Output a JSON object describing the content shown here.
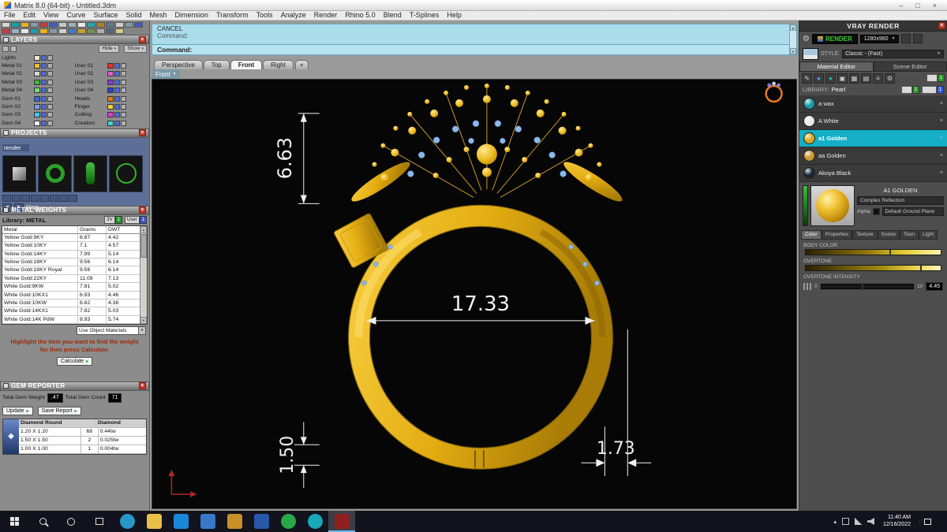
{
  "window": {
    "title": "Matrix 8.0 (64-bit) - Untitled.3dm",
    "minimize": "–",
    "maximize": "□",
    "close": "×"
  },
  "menu": {
    "items": [
      "File",
      "Edit",
      "View",
      "Curve",
      "Surface",
      "Solid",
      "Mesh",
      "Dimension",
      "Transform",
      "Tools",
      "Analyze",
      "Render",
      "Rhino 5.0",
      "Blend",
      "T-Splines",
      "Help"
    ]
  },
  "toolbar": {
    "icons": [
      "#d8d8d8",
      "#18a0a8",
      "#e8b020",
      "#8898a8",
      "#c04040",
      "#4060c0",
      "#c8c8c8",
      "#98b0c0",
      "#e8e8e8",
      "#20a8b0",
      "#b08020",
      "#607890",
      "#d0d0d0",
      "#8898a8",
      "#4060c0",
      "#c04040",
      "#98b0c0",
      "#e8e8e8",
      "#18a0a8",
      "#e8b020",
      "#8898a8",
      "#d0d0d0",
      "#4878c8",
      "#c8a030",
      "#789058",
      "#b0b0b0",
      "#506880",
      "#d8c890"
    ]
  },
  "layers": {
    "title": "LAYERS",
    "hide_label": "Hide",
    "show_label": "Show",
    "rows": [
      {
        "l_label": "Lights",
        "l_color": "#f0ead0",
        "r_label": "",
        "r_color": "transparent"
      },
      {
        "l_label": "Metal 01",
        "l_color": "#e8c030",
        "r_label": "User 01",
        "r_color": "#e03030"
      },
      {
        "l_label": "Metal 02",
        "l_color": "#d8d8d8",
        "r_label": "User 02",
        "r_color": "#e060d0"
      },
      {
        "l_label": "Metal 03",
        "l_color": "#38b838",
        "r_label": "User 03",
        "r_color": "#8040d0"
      },
      {
        "l_label": "Metal 04",
        "l_color": "#70e070",
        "r_label": "User 04",
        "r_color": "#3040c8"
      },
      {
        "l_label": "Gem 01",
        "l_color": "#3868e0",
        "r_label": "Heads",
        "r_color": "#e07820"
      },
      {
        "l_label": "Gem 02",
        "l_color": "#78a0f0",
        "r_label": "Finger",
        "r_color": "#e8d040"
      },
      {
        "l_label": "Gem 03",
        "l_color": "#40c8e8",
        "r_label": "Cutting",
        "r_color": "#d840c8"
      },
      {
        "l_label": "Gem 04",
        "l_color": "#f0f0f0",
        "r_label": "Creation",
        "r_color": "#40d8d0"
      }
    ]
  },
  "projects": {
    "title": "PROJECTS",
    "item_label": "render",
    "nav_label": "Magr"
  },
  "metal_weights": {
    "title": "METAL WEIGHTS",
    "library_label": "Library: METAL",
    "toggle_3v": "3V",
    "toggle_user": "User",
    "toggle_val": "1",
    "columns": [
      "Metal",
      "Grams",
      "DWT"
    ],
    "rows": [
      [
        "Yellow Gold:9KY",
        "6.87",
        "4.42"
      ],
      [
        "Yellow Gold:10KY",
        "7.1",
        "4.57"
      ],
      [
        "Yellow Gold:14KY",
        "7.99",
        "5.14"
      ],
      [
        "Yellow Gold:18KY",
        "9.56",
        "6.14"
      ],
      [
        "Yellow Gold:18KY Royal",
        "9.56",
        "6.14"
      ],
      [
        "Yellow Gold:22KY",
        "11.09",
        "7.13"
      ],
      [
        "White Gold:9KW",
        "7.81",
        "5.02"
      ],
      [
        "White Gold:10KX1",
        "6.93",
        "4.46"
      ],
      [
        "White Gold:10KW",
        "6.82",
        "4.38"
      ],
      [
        "White Gold:14KX1",
        "7.82",
        "5.03"
      ],
      [
        "White Gold:14K PdW",
        "8.93",
        "5.74"
      ]
    ],
    "materials_dropdown": "Use Object Materials",
    "hint_line1": "Highlight the item you want to find the weight",
    "hint_line2": "for then press Calculate.",
    "calculate_label": "Calculate"
  },
  "gem_reporter": {
    "title": "GEM REPORTER",
    "total_weight_label": "Total Gem Weight",
    "total_weight_value": ".47",
    "total_count_label": "Total Gem Count",
    "total_count_value": "71",
    "update_label": "Update",
    "save_label": "Save Report",
    "table": {
      "header1": "Diamond Round",
      "header2": "Diamond",
      "rows": [
        [
          "1.20 X 1.20",
          "68",
          "0.44tw"
        ],
        [
          "1.50 X 1.50",
          "2",
          "0.025tw"
        ],
        [
          "1.00 X 1.00",
          "1",
          "0.004tw"
        ]
      ]
    }
  },
  "command": {
    "cancel_label": "CANCEL",
    "line2": "Command:",
    "prompt": "Command:"
  },
  "viewport": {
    "tabs": [
      {
        "label": "Perspective"
      },
      {
        "label": "Top"
      },
      {
        "label": "Front",
        "selected": true
      },
      {
        "label": "Right"
      }
    ],
    "plus_label": "+",
    "view_chip": "Front",
    "dim_height": "6.63",
    "dim_diameter": "17.33",
    "dim_thickness": "1.50",
    "dim_width": "1.73"
  },
  "vray": {
    "title": "VRAY RENDER",
    "render_label": "RENDER",
    "resolution": "1280x960",
    "style_label": "STYLE:",
    "style_value": "Classic - (Fast)",
    "tab_material": "Material Editor",
    "tab_scene": "Scene Editor",
    "tools": [
      {
        "name": "eyedropper-icon",
        "glyph": "✎",
        "color": "#d8d8d8"
      },
      {
        "name": "sphere-blue-icon",
        "glyph": "●",
        "color": "#48a0e8"
      },
      {
        "name": "sphere-teal-icon",
        "glyph": "●",
        "color": "#20b8a8"
      },
      {
        "name": "box-icon",
        "glyph": "▣",
        "color": "#d0d0d0"
      },
      {
        "name": "checker-icon",
        "glyph": "▦",
        "color": "#d0d0d0"
      },
      {
        "name": "layers-icon",
        "glyph": "▤",
        "color": "#d0d0d0"
      },
      {
        "name": "list-icon",
        "glyph": "≡",
        "color": "#d0d0d0"
      },
      {
        "name": "gear-icon",
        "glyph": "⚙",
        "color": "#d0d0d0"
      }
    ],
    "library_label": "LIBRARY:",
    "library_value": "Pearl",
    "toggle_3v": "3V",
    "toggle_user": "User",
    "toggle_val": "1",
    "materials": [
      {
        "name": "a wax",
        "color": "#1898a0"
      },
      {
        "name": "A White",
        "color": "#e8e8e8"
      },
      {
        "name": "a1 Golden",
        "color": "#d8a820",
        "selected": true
      },
      {
        "name": "aa Golden",
        "color": "#c89830"
      },
      {
        "name": "Akoya Black",
        "color": "#182838"
      }
    ],
    "preview_name": "A1 GOLDEN",
    "reflection_label": "Complex Reflection",
    "alpha_label": "Alpha",
    "ground_label": "Default Ground Plane",
    "prop_tabs": [
      {
        "label": "Color",
        "selected": true
      },
      {
        "label": "Properties"
      },
      {
        "label": "Texture"
      },
      {
        "label": "Scene"
      },
      {
        "label": "Toon"
      },
      {
        "label": "Light"
      }
    ],
    "body_color_label": "BODY COLOR",
    "overtone_label": "OVERTONE",
    "intensity_label": "OVERTONE INTENSITY",
    "intensity_min": "0",
    "intensity_max": "10",
    "intensity_value": "4.45",
    "accent_selected": "#14aec6"
  },
  "taskbar": {
    "time": "11:40 AM",
    "date": "12/16/2022",
    "apps": [
      {
        "name": "edge",
        "color": "#2898c8",
        "radius": "50%"
      },
      {
        "name": "file-explorer",
        "color": "#e8c048",
        "radius": "3px"
      },
      {
        "name": "store",
        "color": "#1888d8",
        "radius": "3px"
      },
      {
        "name": "app-blue",
        "color": "#3878c8",
        "radius": "3px"
      },
      {
        "name": "app-gold",
        "color": "#c89028",
        "radius": "3px"
      },
      {
        "name": "app-indigo",
        "color": "#2858a8",
        "radius": "3px"
      },
      {
        "name": "app-green",
        "color": "#28a848",
        "radius": "50%"
      },
      {
        "name": "app-teal",
        "color": "#18a8b8",
        "radius": "50%"
      },
      {
        "name": "matrix",
        "color": "#902020",
        "radius": "3px",
        "selected": true
      }
    ]
  }
}
